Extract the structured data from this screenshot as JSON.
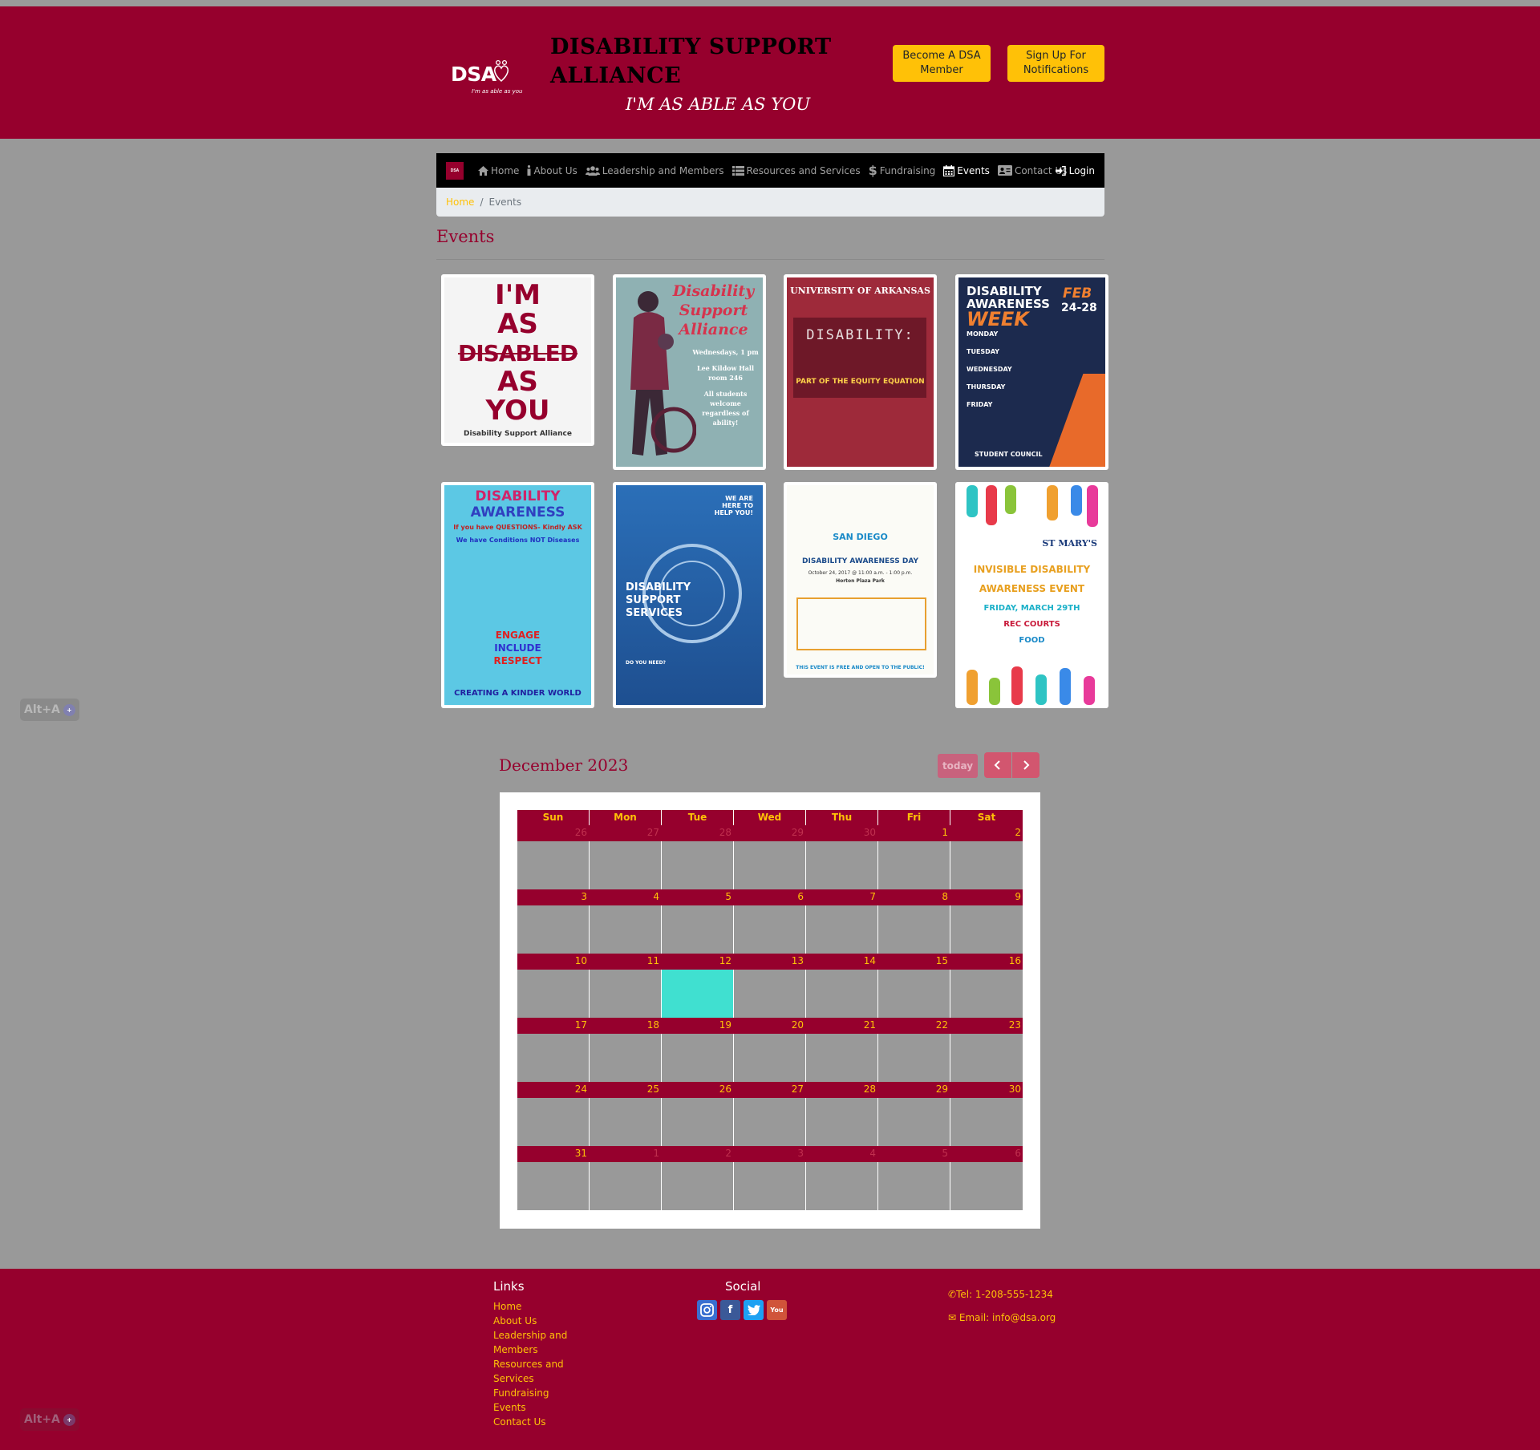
{
  "header": {
    "logo_text": "DSA",
    "logo_tagline": "I'm as able as you",
    "title": "DISABILITY SUPPORT ALLIANCE",
    "tagline": "I'M AS ABLE AS YOU",
    "become_member_label": "Become A DSA Member",
    "signup_label": "Sign Up For Notifications"
  },
  "nav": {
    "brand": "DSA",
    "items": [
      {
        "label": "Home",
        "icon": "home-icon"
      },
      {
        "label": "About Us",
        "icon": "info-icon"
      },
      {
        "label": "Leadership and Members",
        "icon": "users-icon"
      },
      {
        "label": "Resources and Services",
        "icon": "list-icon"
      },
      {
        "label": "Fundraising",
        "icon": "dollar-icon"
      },
      {
        "label": "Events",
        "icon": "calendar-icon"
      },
      {
        "label": "Contact Us",
        "icon": "address-card-icon"
      }
    ],
    "login_label": "Login",
    "active": "Events"
  },
  "breadcrumb": {
    "home": "Home",
    "current": "Events"
  },
  "page_title": "Events",
  "posters": [
    {
      "lines": [
        "I'M",
        "AS",
        "DISABLED",
        "AS",
        "YOU",
        "Disability Support Alliance"
      ]
    },
    {
      "lines": [
        "Disability",
        "Support",
        "Alliance",
        "Wednesdays, 1 pm",
        "Lee Kildow Hall",
        "room 246",
        "All students",
        "welcome",
        "regardless of",
        "ability!"
      ]
    },
    {
      "lines": [
        "UNIVERSITY OF ARKANSAS",
        "DISABILITY:",
        "PART OF THE EQUITY EQUATION"
      ]
    },
    {
      "lines": [
        "DISABILITY",
        "AWARENESS",
        "WEEK",
        "FEB",
        "24-28",
        "MONDAY",
        "TUESDAY",
        "WEDNESDAY",
        "THURSDAY",
        "FRIDAY",
        "STUDENT COUNCIL"
      ]
    },
    {
      "lines": [
        "DISABILITY",
        "AWARENESS",
        "If you have QUESTIONS- Kindly ASK",
        "We have Conditions NOT Diseases",
        "ENGAGE",
        "INCLUDE",
        "RESPECT",
        "CREATING A KINDER WORLD"
      ]
    },
    {
      "lines": [
        "WE ARE HERE TO HELP YOU!",
        "DISABILITY",
        "SUPPORT",
        "SERVICES",
        "DO YOU NEED?"
      ]
    },
    {
      "lines": [
        "SAN DIEGO",
        "DISABILITY AWARENESS DAY",
        "October 24, 2017 @ 11:00 a.m. - 1:00 p.m.",
        "Horton Plaza Park",
        "THIS EVENT IS FREE AND OPEN TO THE PUBLIC!"
      ]
    },
    {
      "lines": [
        "ST MARY'S",
        "INVISIBLE DISABILITY",
        "AWARENESS EVENT",
        "FRIDAY, MARCH 29TH",
        "REC COURTS",
        "FOOD"
      ]
    }
  ],
  "calendar": {
    "title": "December 2023",
    "today_label": "today",
    "days_of_week": [
      "Sun",
      "Mon",
      "Tue",
      "Wed",
      "Thu",
      "Fri",
      "Sat"
    ],
    "weeks": [
      [
        "26",
        "27",
        "28",
        "29",
        "30",
        "1",
        "2"
      ],
      [
        "3",
        "4",
        "5",
        "6",
        "7",
        "8",
        "9"
      ],
      [
        "10",
        "11",
        "12",
        "13",
        "14",
        "15",
        "16"
      ],
      [
        "17",
        "18",
        "19",
        "20",
        "21",
        "22",
        "23"
      ],
      [
        "24",
        "25",
        "26",
        "27",
        "28",
        "29",
        "30"
      ],
      [
        "31",
        "1",
        "2",
        "3",
        "4",
        "5",
        "6"
      ]
    ],
    "other_month": [
      [
        0,
        0
      ],
      [
        0,
        1
      ],
      [
        0,
        2
      ],
      [
        0,
        3
      ],
      [
        0,
        4
      ],
      [
        5,
        1
      ],
      [
        5,
        2
      ],
      [
        5,
        3
      ],
      [
        5,
        4
      ],
      [
        5,
        5
      ],
      [
        5,
        6
      ]
    ],
    "today_cell": [
      2,
      2
    ],
    "today_color": "#40e0d0"
  },
  "footer": {
    "links_heading": "Links",
    "links": [
      "Home",
      "About Us",
      "Leadership and Members",
      "Resources and Services",
      "Fundraising",
      "Events",
      "Contact Us"
    ],
    "social_heading": "Social",
    "social_icons": [
      "instagram-icon",
      "facebook-icon",
      "twitter-icon",
      "youtube-icon"
    ],
    "tel": "Tel: 1-208-555-1234",
    "email": "Email: info@dsa.org"
  },
  "accessibility_badge": "Alt+A",
  "colors": {
    "brand": "#96002d",
    "accent": "#ffc107",
    "page_bg": "#999999"
  }
}
